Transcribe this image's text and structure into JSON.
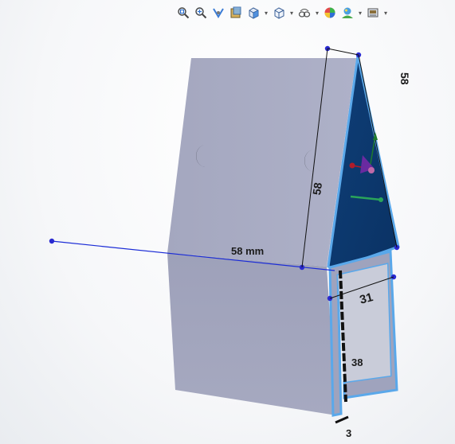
{
  "toolbar": {
    "icons": [
      {
        "name": "zoom-to-fit-icon"
      },
      {
        "name": "zoom-to-area-icon"
      },
      {
        "name": "previous-view-icon"
      },
      {
        "name": "section-view-icon"
      },
      {
        "name": "view-orientation-icon",
        "dropdown": true
      },
      {
        "name": "display-style-icon",
        "dropdown": true
      },
      {
        "name": "hide-show-items-icon",
        "dropdown": true
      },
      {
        "name": "edit-appearance-icon"
      },
      {
        "name": "apply-scene-icon",
        "dropdown": true
      },
      {
        "name": "view-settings-icon",
        "dropdown": true
      }
    ]
  },
  "dimensions": {
    "upper_right_angled": "58",
    "slanted_edge": "58",
    "horizontal": "58 mm",
    "channel_width": "31",
    "channel_depth": "38",
    "thickness": "3"
  },
  "colors": {
    "part_face_light": "#a9acc3",
    "part_face_side": "#9699b0",
    "selected_face": "#0d3b73",
    "selection_outline": "#5aa8ea",
    "sketch_line": "#1a2bd6",
    "dimension_line": "#111111"
  }
}
